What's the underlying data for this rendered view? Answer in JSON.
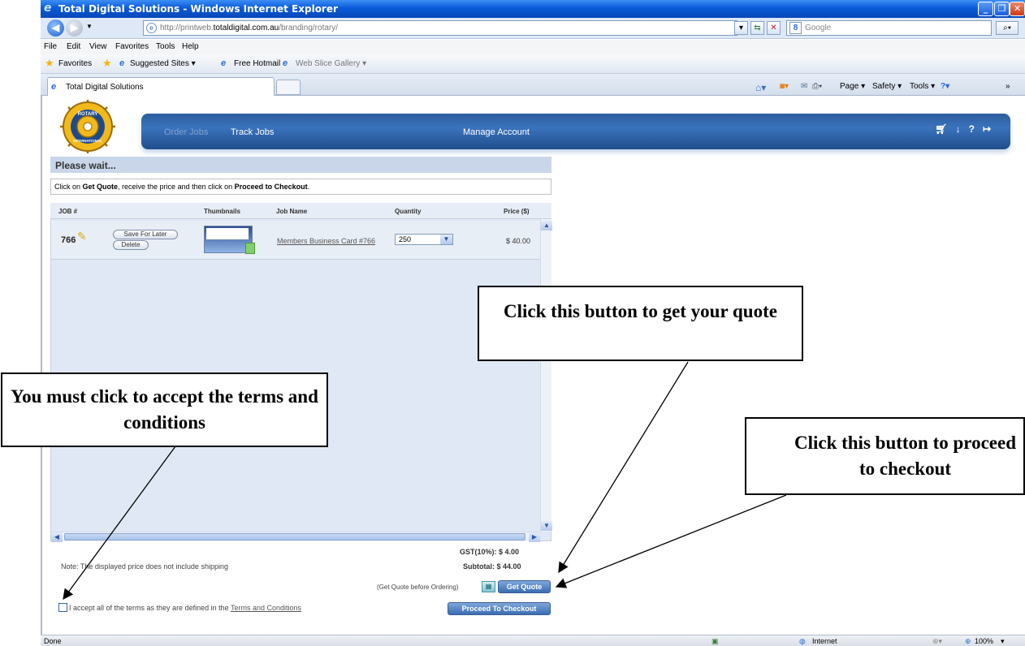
{
  "window": {
    "title": "Total Digital Solutions - Windows Internet Explorer",
    "url_prefix": "http://printweb.",
    "url_host": "totaldigital.com.au",
    "url_path": "/branding/rotary/",
    "search_placeholder": "Google"
  },
  "menu": [
    "File",
    "Edit",
    "View",
    "Favorites",
    "Tools",
    "Help"
  ],
  "favorites": {
    "label": "Favorites",
    "items": [
      "Suggested Sites ▾",
      "Free Hotmail",
      "Web Slice Gallery ▾"
    ]
  },
  "tab": {
    "title": "Total Digital Solutions"
  },
  "commandbar": [
    "Page ▾",
    "Safety ▾",
    "Tools ▾"
  ],
  "site": {
    "logo_text_top": "ROTARY",
    "logo_text_bottom": "INTERNATIONAL",
    "nav": {
      "order_jobs": "Order Jobs",
      "track_jobs": "Track Jobs",
      "manage_account": "Manage Account"
    },
    "please_wait": "Please wait...",
    "instruction": {
      "p1": "Click on ",
      "b1": "Get Quote",
      "p2": ", receive the price and then click on ",
      "b2": "Proceed to Checkout",
      "p3": "."
    }
  },
  "table": {
    "headers": {
      "job": "JOB #",
      "thumbnails": "Thumbnails",
      "job_name": "Job Name",
      "quantity": "Quantity",
      "price": "Price ($)"
    },
    "rows": [
      {
        "job": "766",
        "save_label": "Save For Later",
        "delete_label": "Delete",
        "job_name": "Members Business Card #766",
        "quantity": "250",
        "price": "$ 40.00"
      }
    ]
  },
  "totals": {
    "gst": "GST(10%): $ 4.00",
    "subtotal": "Subtotal: $ 44.00",
    "note": "Note: The displayed price does not include shipping"
  },
  "actions": {
    "get_quote_hint": "(Get Quote before Ordering)",
    "get_quote": "Get Quote",
    "checkout": "Proceed To Checkout",
    "terms_text": "I accept all of the terms as they are defined in the ",
    "terms_link": "Terms and Conditions"
  },
  "status": {
    "left": "Done",
    "zone": "Internet",
    "zoom": "100%"
  },
  "callouts": {
    "quote": "Click this button to get your quote",
    "terms": "You must click to accept the terms and conditions",
    "checkout": "Click this button to proceed to checkout"
  }
}
